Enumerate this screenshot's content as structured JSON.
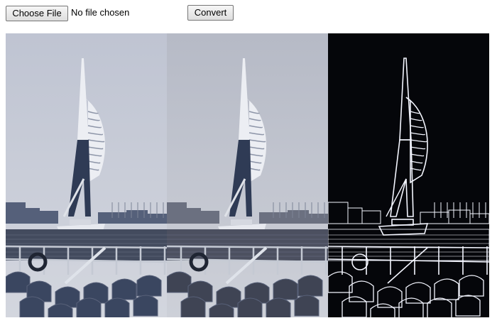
{
  "toolbar": {
    "choose_file_label": "Choose File",
    "file_status": "No file chosen",
    "convert_label": "Convert"
  },
  "panels": [
    {
      "name": "original-image",
      "mode": "color"
    },
    {
      "name": "grayscale-image",
      "mode": "gray"
    },
    {
      "name": "edge-detection-image",
      "mode": "edges"
    }
  ],
  "colors": {
    "sky_top": "#bfc4d2",
    "sky_bottom": "#d3d6de",
    "tower": "#eceef3",
    "tower_dark": "#2f3b55",
    "water": "#434b5e",
    "seats": "#3a4660",
    "edge_bg": "#05060a",
    "edge_line": "#f4f6ff"
  }
}
